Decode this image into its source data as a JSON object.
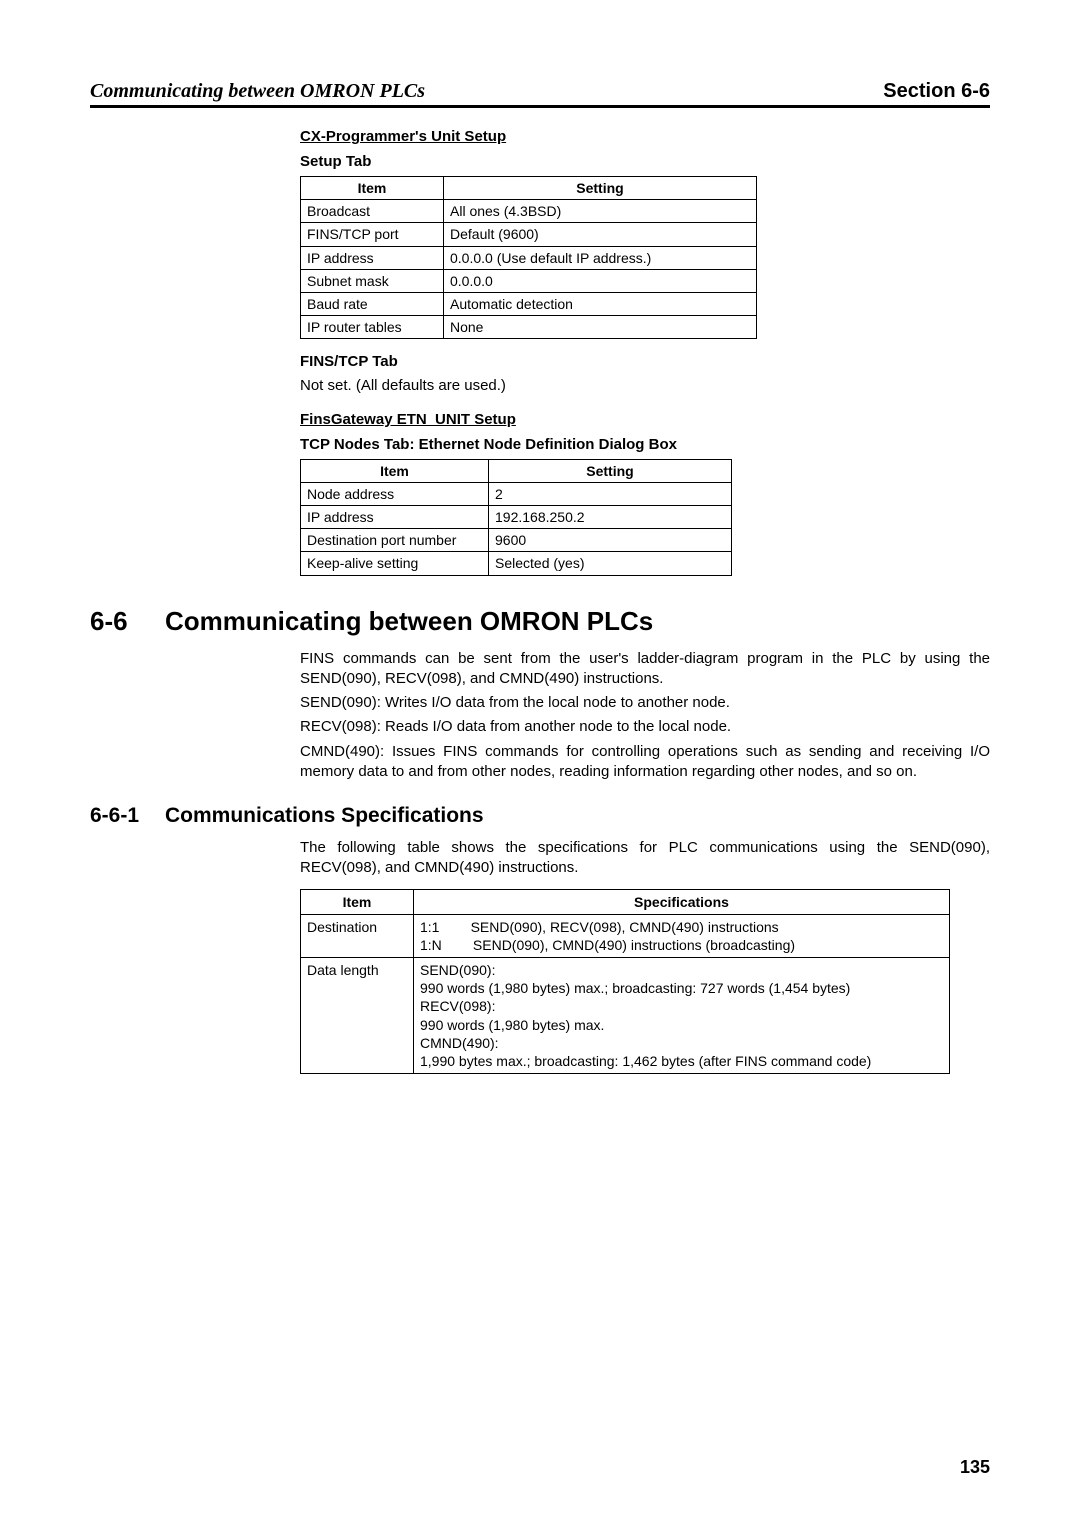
{
  "header": {
    "left": "Communicating between OMRON PLCs",
    "right": "Section 6-6"
  },
  "cx_heading": "CX-Programmer's Unit Setup",
  "setup_tab_label": "Setup Tab",
  "table1": {
    "col_item": "Item",
    "col_setting": "Setting",
    "rows": [
      {
        "item": "Broadcast",
        "setting": "All ones (4.3BSD)"
      },
      {
        "item": "FINS/TCP port",
        "setting": "Default (9600)"
      },
      {
        "item": "IP address",
        "setting": "0.0.0.0 (Use default IP address.)"
      },
      {
        "item": "Subnet mask",
        "setting": "0.0.0.0"
      },
      {
        "item": "Baud rate",
        "setting": "Automatic detection"
      },
      {
        "item": "IP router tables",
        "setting": "None"
      }
    ]
  },
  "fins_tcp_tab_label": "FINS/TCP Tab",
  "fins_tcp_note": "Not set. (All defaults are used.)",
  "finsgw_heading": "FinsGateway ETN_UNIT Setup",
  "tcp_nodes_heading": "TCP Nodes Tab: Ethernet Node Definition Dialog Box",
  "table2": {
    "col_item": "Item",
    "col_setting": "Setting",
    "rows": [
      {
        "item": "Node address",
        "setting": "2"
      },
      {
        "item": "IP address",
        "setting": "192.168.250.2"
      },
      {
        "item": "Destination port number",
        "setting": "9600"
      },
      {
        "item": "Keep-alive setting",
        "setting": "Selected (yes)"
      }
    ]
  },
  "section": {
    "num": "6-6",
    "title": "Communicating between OMRON PLCs",
    "p1": "FINS commands can be sent from the user's ladder-diagram program in the PLC by using the SEND(090), RECV(098), and CMND(490) instructions.",
    "p2": "SEND(090): Writes I/O data from the local node to another node.",
    "p3": "RECV(098): Reads I/O data from another node to the local node.",
    "p4": "CMND(490): Issues FINS commands for controlling operations such as sending and receiving I/O memory data to and from other nodes, reading information regarding other nodes, and so on."
  },
  "subsection": {
    "num": "6-6-1",
    "title": "Communications Specifications",
    "intro": "The following table shows the specifications for PLC communications using the SEND(090), RECV(098), and CMND(490) instructions."
  },
  "spec_table": {
    "col_item": "Item",
    "col_spec": "Specifications",
    "rows": [
      {
        "item": "Destination",
        "spec": "1:1        SEND(090), RECV(098), CMND(490) instructions\n1:N        SEND(090), CMND(490) instructions (broadcasting)"
      },
      {
        "item": "Data length",
        "spec": "SEND(090):\n990 words (1,980 bytes) max.; broadcasting: 727 words (1,454 bytes)\nRECV(098):\n990 words (1,980 bytes) max.\nCMND(490):\n1,990 bytes max.; broadcasting: 1,462 bytes (after FINS command code)"
      }
    ]
  },
  "page_number": "135"
}
